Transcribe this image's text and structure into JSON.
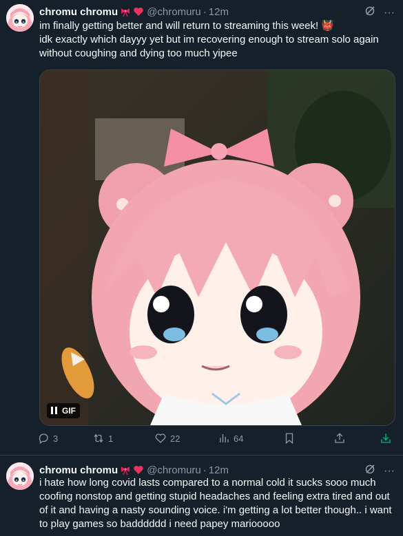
{
  "tweets": [
    {
      "display_name": "chromu chromu",
      "handle": "@chromuru",
      "separator": "·",
      "time": "12m",
      "body": "im finally getting better and will return to streaming this week! 👹\nidk exactly which dayyy yet but im recovering enough to stream solo again without coughing and dying too much yipee",
      "media": {
        "badge": "GIF",
        "paused": true
      },
      "stats": {
        "replies": "3",
        "reposts": "1",
        "likes": "22",
        "views": "64"
      }
    },
    {
      "display_name": "chromu chromu",
      "handle": "@chromuru",
      "separator": "·",
      "time": "12m",
      "body": "i hate how long covid lasts compared to a normal cold it sucks sooo much coofing nonstop and getting stupid headaches and feeling extra tired and out of it and having a nasty sounding voice. i'm getting a lot better though.. i want to play games so badddddd i need papey mariooooo"
    }
  ],
  "more_label": "···",
  "colors": {
    "background": "#15202b",
    "text": "#f7f9f9",
    "muted": "#8b98a5",
    "accent_green": "#00ba7c",
    "border": "#38444d"
  }
}
